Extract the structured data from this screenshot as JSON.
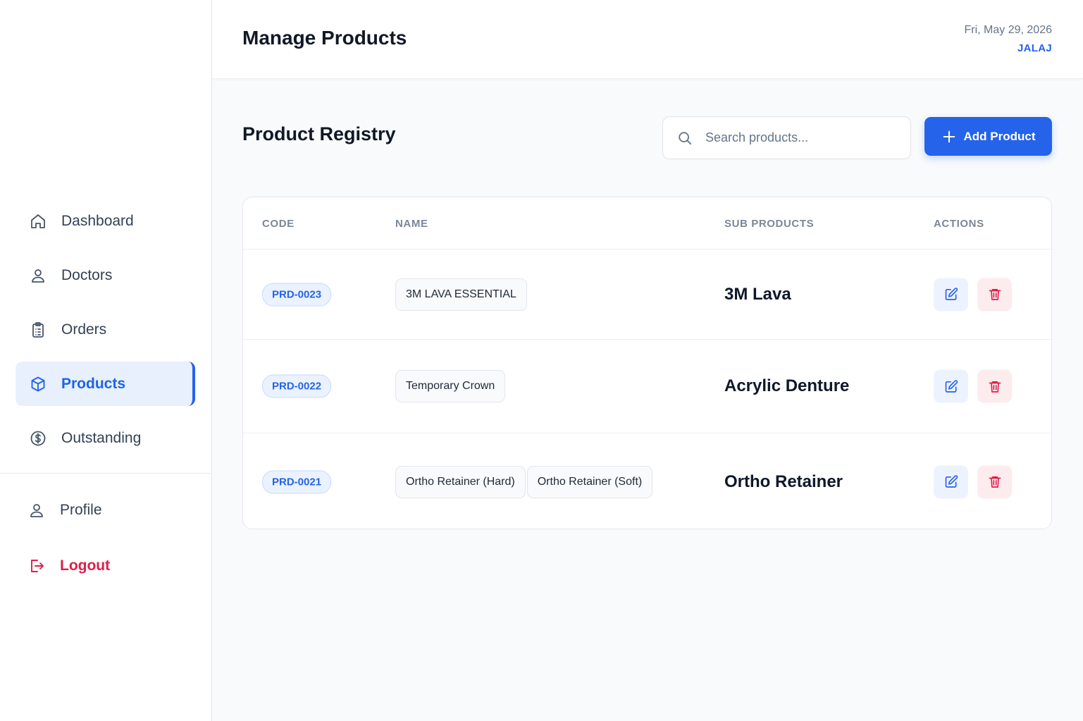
{
  "header": {
    "title": "Manage Products",
    "date": "Fri, May 29, 2026",
    "user": "JALAJ"
  },
  "sidebar": {
    "items": [
      {
        "label": "Dashboard",
        "icon": "home-icon"
      },
      {
        "label": "Doctors",
        "icon": "user-icon"
      },
      {
        "label": "Orders",
        "icon": "clipboard-icon"
      },
      {
        "label": "Products",
        "icon": "box-icon",
        "active": true
      },
      {
        "label": "Outstanding",
        "icon": "dollar-circle-icon"
      }
    ],
    "bottom": [
      {
        "label": "Profile",
        "icon": "user-icon"
      },
      {
        "label": "Logout",
        "icon": "logout-icon"
      }
    ]
  },
  "registry": {
    "title": "Product Registry",
    "search_placeholder": "Search products...",
    "add_label": "Add Product"
  },
  "table": {
    "columns": [
      "CODE",
      "NAME",
      "SUB PRODUCTS",
      "ACTIONS"
    ],
    "rows": [
      {
        "code": "PRD-0023",
        "names": [
          "3M LAVA ESSENTIAL"
        ],
        "sub_product": "3M Lava"
      },
      {
        "code": "PRD-0022",
        "names": [
          "Temporary Crown"
        ],
        "sub_product": "Acrylic Denture"
      },
      {
        "code": "PRD-0021",
        "names": [
          "Ortho Retainer (Hard)",
          "Ortho Retainer (Soft)"
        ],
        "sub_product": "Ortho Retainer"
      }
    ]
  },
  "colors": {
    "accent": "#2563eb",
    "danger": "#e11d48",
    "active_bg": "#e8f0fe"
  }
}
